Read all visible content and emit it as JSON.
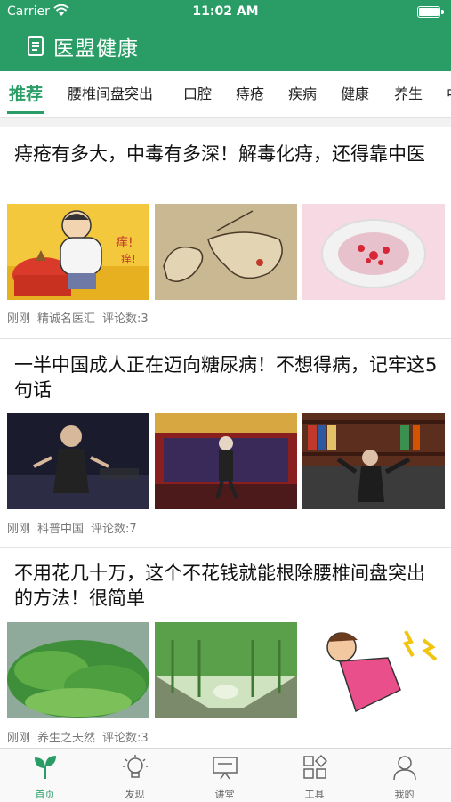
{
  "status_bar": {
    "carrier": "Carrier",
    "time": "11:02 AM"
  },
  "header": {
    "title": "医盟健康"
  },
  "tabs": [
    "推荐",
    "腰椎间盘突出",
    "口腔",
    "痔疮",
    "疾病",
    "健康",
    "养生",
    "中"
  ],
  "articles": [
    {
      "title": "痔疮有多大，中毒有多深！解毒化痔，还得靠中医",
      "time": "刚刚",
      "source": "精诚名医汇",
      "comments": "评论数:3",
      "images": [
        "cartoon-man-eating-image",
        "hand-sketch-image",
        "toilet-petals-image"
      ]
    },
    {
      "title": "一半中国成人正在迈向糖尿病！不想得病，记牢这5句话",
      "time": "刚刚",
      "source": "科普中国",
      "comments": "评论数:7",
      "images": [
        "tv-speaker-image",
        "stage-performer-image",
        "bookshelf-speaker-image"
      ]
    },
    {
      "title": "不用花几十万，这个不花钱就能根除腰椎间盘突出的方法！很简单",
      "time": "刚刚",
      "source": "养生之天然",
      "comments": "评论数:3",
      "images": [
        "green-vegetables-image",
        "vine-tunnel-image",
        "back-pain-cartoon-image"
      ]
    }
  ],
  "tabbar": [
    {
      "label": "首页",
      "icon": "sprout-icon",
      "active": true
    },
    {
      "label": "发现",
      "icon": "lightbulb-icon",
      "active": false
    },
    {
      "label": "讲堂",
      "icon": "lecture-screen-icon",
      "active": false
    },
    {
      "label": "工具",
      "icon": "tools-grid-icon",
      "active": false
    },
    {
      "label": "我的",
      "icon": "user-icon",
      "active": false
    }
  ],
  "colors": {
    "brand": "#2a9d66",
    "tab_active": "#2a9d66",
    "meta_text": "#777777"
  }
}
